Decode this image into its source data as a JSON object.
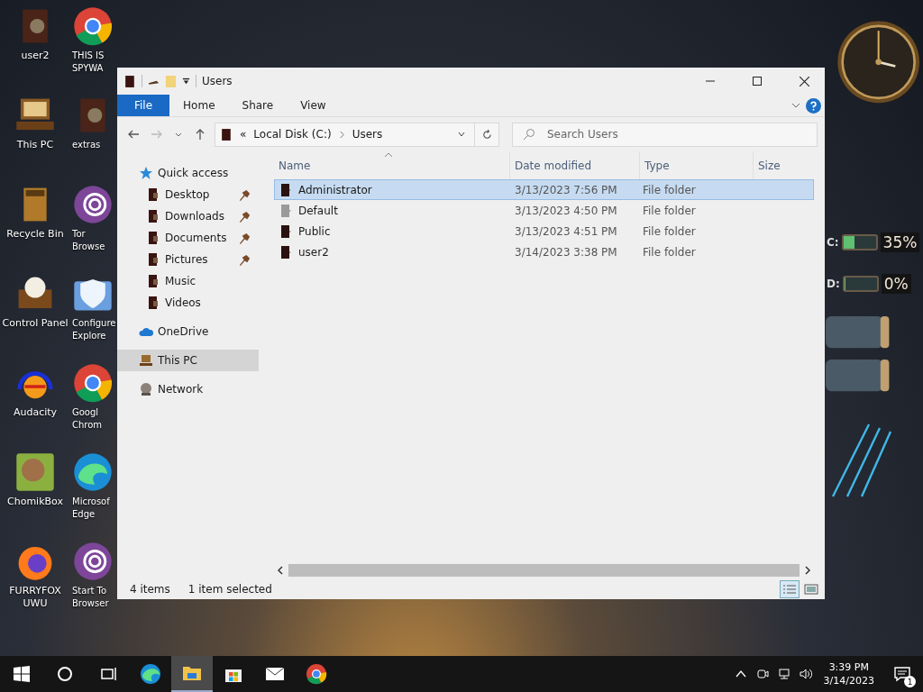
{
  "desktop": {
    "icon_columns": [
      {
        "icons": [
          {
            "label": "user2",
            "kind": "user"
          },
          {
            "label": "This PC",
            "kind": "pc"
          },
          {
            "label": "Recycle Bin",
            "kind": "bin"
          },
          {
            "label": "Control Panel",
            "kind": "bulb"
          },
          {
            "label": "Audacity",
            "kind": "audio"
          },
          {
            "label": "ChomikBox",
            "kind": "box"
          },
          {
            "label": "FURRYFOX UWU",
            "kind": "fox"
          }
        ]
      },
      {
        "icons": [
          {
            "label": "THIS IS SPYWA",
            "kind": "chrome"
          },
          {
            "label": "extras",
            "kind": "user"
          },
          {
            "label": "Tor Browse",
            "kind": "tor"
          },
          {
            "label": "Configure Explore",
            "kind": "shield"
          },
          {
            "label": "Googl Chrom",
            "kind": "chrome"
          },
          {
            "label": "Microsof Edge",
            "kind": "edge"
          },
          {
            "label": "Start To Browser",
            "kind": "tor"
          }
        ]
      }
    ]
  },
  "widgets": {
    "drives": [
      {
        "label": "C:",
        "level": 0.35,
        "reading": "35%"
      },
      {
        "label": "D:",
        "level": 0.0,
        "reading": "0%"
      }
    ]
  },
  "window": {
    "title": "Users",
    "ribbon_tabs": [
      {
        "label": "File",
        "selected": true
      },
      {
        "label": "Home",
        "selected": false
      },
      {
        "label": "Share",
        "selected": false
      },
      {
        "label": "View",
        "selected": false
      }
    ],
    "address": {
      "overflow": "«",
      "path": [
        "Local Disk (C:)",
        "Users"
      ]
    },
    "search": {
      "placeholder": "Search Users"
    },
    "nav": [
      {
        "label": "Quick access",
        "kind": "star",
        "selected": false,
        "children": [
          {
            "label": "Desktop",
            "pinned": true,
            "selected": false
          },
          {
            "label": "Downloads",
            "pinned": true,
            "selected": false
          },
          {
            "label": "Documents",
            "pinned": true,
            "selected": false
          },
          {
            "label": "Pictures",
            "pinned": true,
            "selected": false
          },
          {
            "label": "Music",
            "pinned": false,
            "selected": false
          },
          {
            "label": "Videos",
            "pinned": false,
            "selected": false
          }
        ]
      },
      {
        "label": "OneDrive",
        "kind": "cloud",
        "selected": false
      },
      {
        "label": "This PC",
        "kind": "pc",
        "selected": true
      },
      {
        "label": "Network",
        "kind": "network",
        "selected": false
      }
    ],
    "columns": [
      "Name",
      "Date modified",
      "Type",
      "Size"
    ],
    "rows": [
      {
        "name": "Administrator",
        "date": "3/13/2023 7:56 PM",
        "type": "File folder",
        "selected": true,
        "dimmed": false
      },
      {
        "name": "Default",
        "date": "3/13/2023 4:50 PM",
        "type": "File folder",
        "selected": false,
        "dimmed": true
      },
      {
        "name": "Public",
        "date": "3/13/2023 4:51 PM",
        "type": "File folder",
        "selected": false,
        "dimmed": false
      },
      {
        "name": "user2",
        "date": "3/14/2023 3:38 PM",
        "type": "File folder",
        "selected": false,
        "dimmed": false
      }
    ],
    "status": {
      "count": "4 items",
      "selection": "1 item selected",
      "view_buttons": [
        {
          "kind": "details",
          "selected": true
        },
        {
          "kind": "icons",
          "selected": false
        }
      ]
    }
  },
  "taskbar": {
    "apps": [
      {
        "kind": "edge",
        "active": false
      },
      {
        "kind": "explorer",
        "active": true
      },
      {
        "kind": "store",
        "active": false
      },
      {
        "kind": "mail",
        "active": false
      },
      {
        "kind": "chrome",
        "active": false
      }
    ],
    "time": "3:39 PM",
    "date": "3/14/2023",
    "notifications": "1"
  }
}
